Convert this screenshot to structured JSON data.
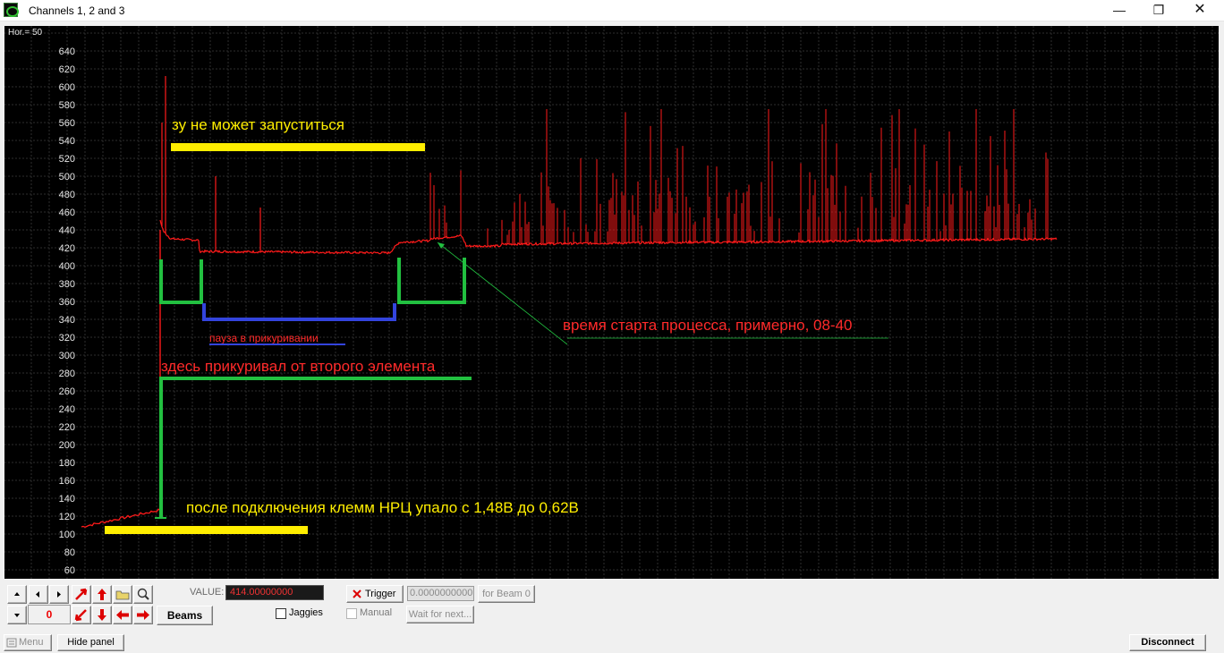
{
  "window": {
    "title": "Channels 1, 2 and 3",
    "min_glyph": "—",
    "max_glyph": "❐",
    "close_glyph": "✕"
  },
  "scope": {
    "hor_label": "Hor.=  50",
    "background": "#000000",
    "grid_color": "#2e2e2e",
    "trace_color": "#ff1a1a"
  },
  "chart_data": {
    "type": "line",
    "ylim": [
      60,
      650
    ],
    "y_ticks": [
      "640",
      "620",
      "600",
      "580",
      "560",
      "540",
      "520",
      "500",
      "480",
      "460",
      "440",
      "420",
      "400",
      "380",
      "360",
      "340",
      "320",
      "300",
      "280",
      "260",
      "240",
      "220",
      "200",
      "180",
      "160",
      "140",
      "120",
      "100",
      "80",
      "60"
    ],
    "baseline_segments": [
      {
        "x": [
          0,
          50,
          85,
          88
        ],
        "y": [
          108,
          118,
          126,
          127
        ]
      },
      {
        "x": [
          88,
          90,
          92,
          100,
          130,
          132,
          345,
          350,
          390,
          425,
          1090
        ],
        "y": [
          440,
          455,
          438,
          430,
          428,
          416,
          414,
          425,
          428,
          433,
          430
        ]
      }
    ],
    "spikes": [
      {
        "x": 94,
        "y": 612
      },
      {
        "x": 90,
        "y": 560
      },
      {
        "x": 150,
        "y": 500
      },
      {
        "x": 200,
        "y": 465
      }
    ]
  },
  "annotations": {
    "a1": "зу не может запуститься",
    "a2": "пауза в прикуривании",
    "a3": "время старта процесса, примерно, 08-40",
    "a4": "здесь прикуривал от второго элемента",
    "a5": "после подключения клемм НРЦ упало с 1,48В до 0,62В",
    "colors": {
      "yellow": "#ffee00",
      "green": "#22c040",
      "blue": "#3344dd",
      "red_text": "#ff2a2a"
    }
  },
  "toolbar": {
    "value_label": "VALUE:",
    "value": "414.00000000",
    "trigger_label": "Trigger",
    "trigger_value": "0.0000000000",
    "for_beam": "for Beam 0",
    "jaggies": "Jaggies",
    "manual": "Manual",
    "wait_next": "Wait for next...",
    "beams": "Beams",
    "zero_value": "0"
  },
  "statusbar": {
    "menu": "Menu",
    "hide_panel": "Hide panel",
    "disconnect": "Disconnect"
  }
}
